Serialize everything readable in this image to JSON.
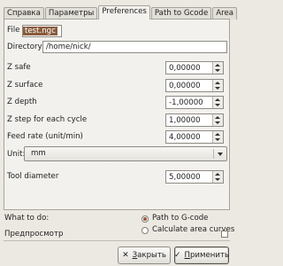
{
  "tabs": [
    {
      "label": "Справка",
      "active": false
    },
    {
      "label": "Параметры",
      "active": false
    },
    {
      "label": "Preferences",
      "active": true
    },
    {
      "label": "Path to Gcode",
      "active": false
    },
    {
      "label": "Area",
      "active": false
    }
  ],
  "file": {
    "label": "File",
    "value": "test.ngc"
  },
  "directory": {
    "label": "Directory",
    "value": "/home/nick/"
  },
  "fields": {
    "z_safe": {
      "label": "Z safe",
      "value": "0,00000"
    },
    "z_surface": {
      "label": "Z surface",
      "value": "0,00000"
    },
    "z_depth": {
      "label": "Z depth",
      "value": "-1,00000"
    },
    "z_step": {
      "label": "Z step for each cycle",
      "value": "1,00000"
    },
    "feed_rate": {
      "label": "Feed rate (unit/min)",
      "value": "4,00000"
    },
    "tool_diameter": {
      "label": "Tool diameter",
      "value": "5,00000"
    }
  },
  "unit": {
    "label": "Unit:",
    "value": "mm"
  },
  "what_to_do": {
    "label": "What to do:",
    "options": [
      {
        "label": "Path to G-code",
        "selected": true
      },
      {
        "label": "Calculate area curves",
        "selected": false
      }
    ]
  },
  "preview": {
    "label": "Предпросмотр",
    "checked": false
  },
  "buttons": {
    "close": {
      "label": "Закрыть",
      "underline": "З",
      "rest": "акрыть",
      "icon": "close-icon"
    },
    "apply": {
      "label": "Применить",
      "underline": "П",
      "rest": "рименить",
      "icon": "apply-icon"
    }
  }
}
